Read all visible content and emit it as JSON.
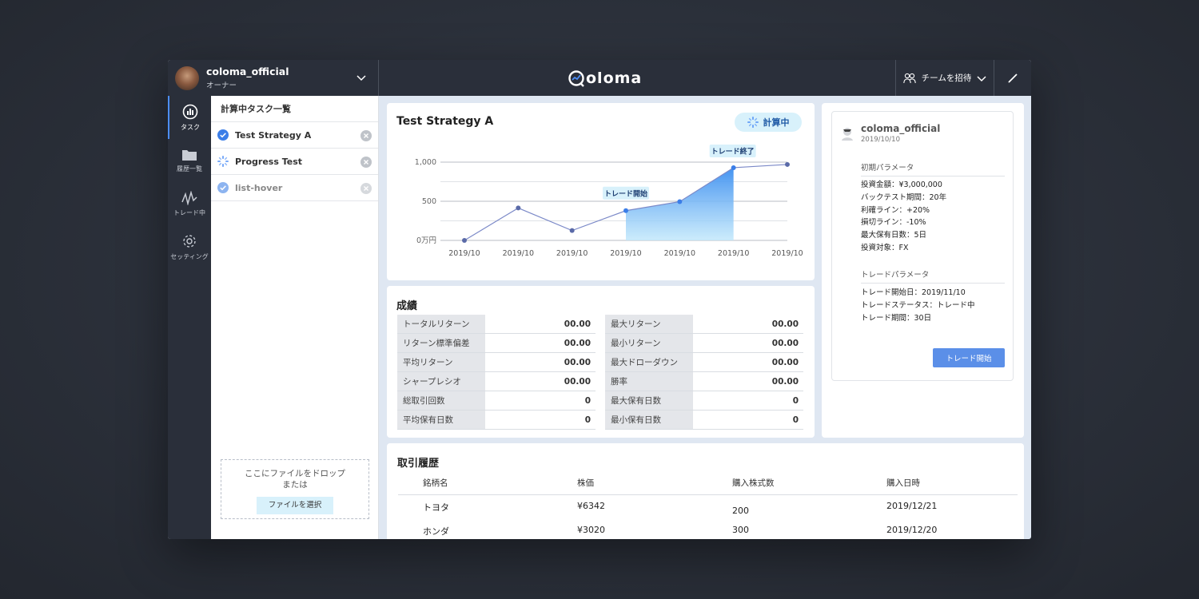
{
  "header": {
    "user_name": "coloma_official",
    "user_role": "オーナー",
    "logo_text": "oloma",
    "invite_label": "チームを招待"
  },
  "nav": [
    {
      "label": "タスク",
      "icon": "chart-icon",
      "active": true
    },
    {
      "label": "履歴一覧",
      "icon": "folder-icon",
      "active": false
    },
    {
      "label": "トレード中",
      "icon": "pulse-icon",
      "active": false
    },
    {
      "label": "セッティング",
      "icon": "gear-icon",
      "active": false
    }
  ],
  "tasks": {
    "title": "計算中タスク一覧",
    "items": [
      {
        "name": "Test Strategy A",
        "status": "done"
      },
      {
        "name": "Progress Test",
        "status": "loading"
      },
      {
        "name": "list-hover",
        "status": "done-hover"
      }
    ],
    "dropzone_line1": "ここにファイルをドロップ",
    "dropzone_line2": "または",
    "select_button": "ファイルを選択"
  },
  "chart_card": {
    "title": "Test Strategy A",
    "status_badge": "計算中",
    "annotation_start": "トレード開始",
    "annotation_end": "トレード終了"
  },
  "chart_data": {
    "type": "line",
    "x": [
      "2019/10",
      "2019/10",
      "2019/10",
      "2019/10",
      "2019/10",
      "2019/10",
      "2019/10"
    ],
    "y_tick_labels": [
      "0万円",
      "500",
      "1,000"
    ],
    "ylim": [
      0,
      1000
    ],
    "points": [
      {
        "x": 0,
        "y": 0
      },
      {
        "x": 1,
        "y": 414
      },
      {
        "x": 2,
        "y": 126
      },
      {
        "x": 3,
        "y": 380
      },
      {
        "x": 4,
        "y": 495
      },
      {
        "x": 5,
        "y": 929
      },
      {
        "x": 6,
        "y": 970
      }
    ],
    "trade_range": [
      3,
      5
    ],
    "grid": true,
    "line_color": "#7b89c8",
    "fill_color": "#3b8ef0"
  },
  "performance": {
    "title": "成績",
    "left": [
      {
        "label": "トータルリターン",
        "value": "00.00"
      },
      {
        "label": "リターン標準偏差",
        "value": "00.00"
      },
      {
        "label": "平均リターン",
        "value": "00.00"
      },
      {
        "label": "シャープレシオ",
        "value": "00.00"
      },
      {
        "label": "総取引回数",
        "value": "0"
      },
      {
        "label": "平均保有日数",
        "value": "0"
      }
    ],
    "right": [
      {
        "label": "最大リターン",
        "value": "00.00"
      },
      {
        "label": "最小リターン",
        "value": "00.00"
      },
      {
        "label": "最大ドローダウン",
        "value": "00.00"
      },
      {
        "label": "勝率",
        "value": "00.00"
      },
      {
        "label": "最大保有日数",
        "value": "0"
      },
      {
        "label": "最小保有日数",
        "value": "0"
      }
    ]
  },
  "params": {
    "user": "coloma_official",
    "date": "2019/10/10",
    "initial_title": "初期パラメータ",
    "initial_lines": [
      "投資金額：¥3,000,000",
      "バックテスト期間：20年",
      "利確ライン：+20%",
      "損切ライン：-10%",
      "最大保有日数：5日",
      "投資対象：FX"
    ],
    "trade_title": "トレードパラメータ",
    "trade_lines": [
      "トレード開始日：2019/11/10",
      "トレードステータス：トレード中",
      "トレード期間：30日"
    ],
    "start_button": "トレード開始"
  },
  "history": {
    "title": "取引履歴",
    "columns": [
      "銘柄名",
      "株価",
      "購入株式数",
      "購入日時"
    ],
    "rows": [
      [
        "トヨタ",
        "¥6342",
        "200",
        "2019/12/21"
      ],
      [
        "ホンダ",
        "¥3020",
        "300",
        "2019/12/20"
      ]
    ]
  }
}
